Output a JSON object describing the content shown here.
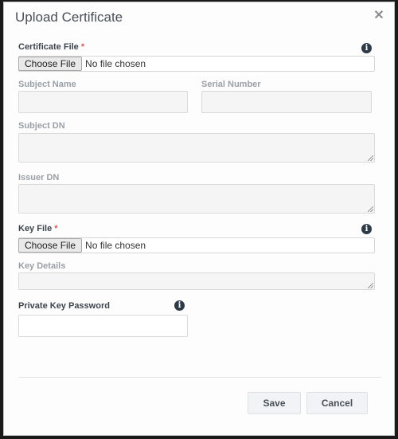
{
  "dialog": {
    "title": "Upload Certificate",
    "close_icon": "close-icon"
  },
  "form": {
    "certificate_file": {
      "label": "Certificate File",
      "required_marker": "*",
      "button_label": "Choose File",
      "status": "No file chosen",
      "info_icon": "info-icon"
    },
    "subject_name": {
      "label": "Subject Name",
      "value": ""
    },
    "serial_number": {
      "label": "Serial Number",
      "value": ""
    },
    "subject_dn": {
      "label": "Subject DN",
      "value": ""
    },
    "issuer_dn": {
      "label": "Issuer DN",
      "value": ""
    },
    "key_file": {
      "label": "Key File",
      "required_marker": "*",
      "button_label": "Choose File",
      "status": "No file chosen",
      "info_icon": "info-icon"
    },
    "key_details": {
      "label": "Key Details",
      "value": ""
    },
    "private_key_password": {
      "label": "Private Key Password",
      "value": "",
      "info_icon": "info-icon"
    }
  },
  "footer": {
    "save_label": "Save",
    "cancel_label": "Cancel"
  },
  "colors": {
    "required": "#e0555a",
    "info_icon_bg": "#2d3a48"
  }
}
